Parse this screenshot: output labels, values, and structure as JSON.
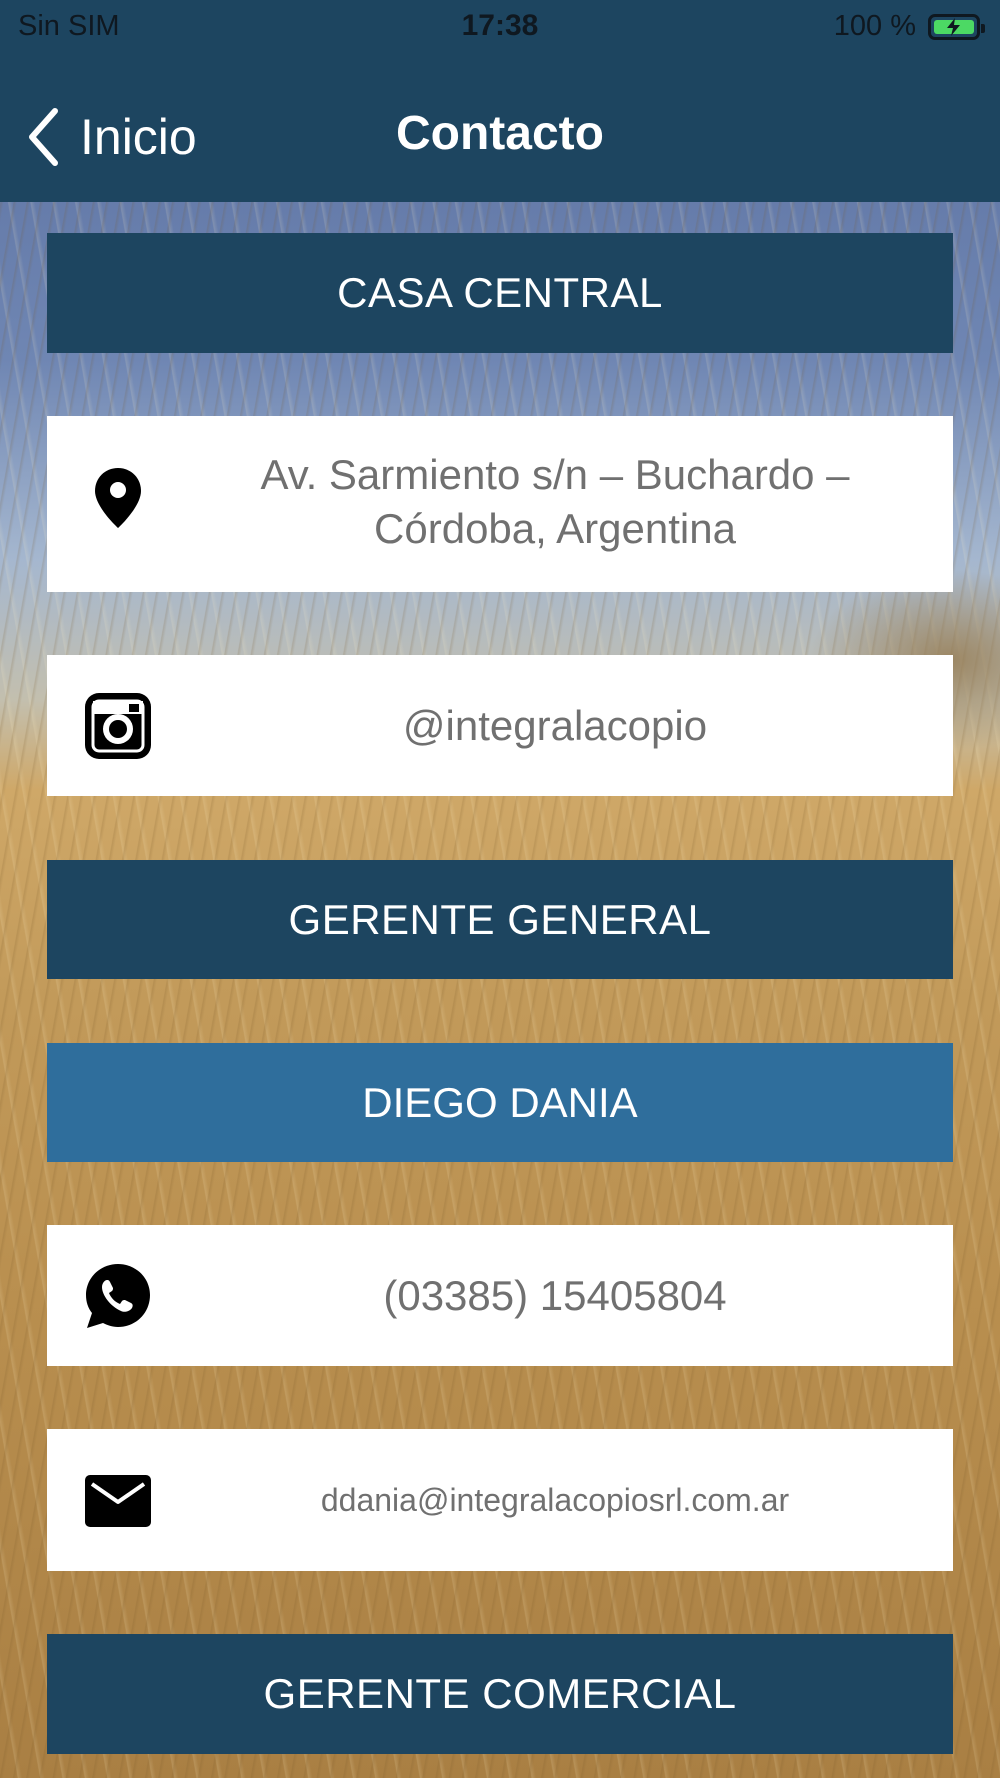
{
  "status_bar": {
    "carrier": "Sin SIM",
    "time": "17:38",
    "battery_text": "100 %",
    "battery_level": 1.0,
    "battery_color": "#4cd964"
  },
  "nav": {
    "back_label": "Inicio",
    "back_icon": "chevron-left-icon",
    "title": "Contacto"
  },
  "sections": {
    "casa_central": {
      "header": "CASA CENTRAL",
      "address": "Av. Sarmiento s/n – Buchardo – Córdoba, Argentina",
      "address_icon": "location-pin-icon",
      "instagram": "@integralacopio",
      "instagram_icon": "instagram-icon"
    },
    "gerente_general": {
      "header": "GERENTE GENERAL",
      "name": "DIEGO DANIA",
      "phone": "(03385) 15405804",
      "phone_icon": "whatsapp-icon",
      "email": "ddania@integralacopiosrl.com.ar",
      "email_icon": "mail-icon"
    },
    "gerente_comercial": {
      "header": "GERENTE COMERCIAL"
    }
  },
  "colors": {
    "header_bg": "#1d4560",
    "name_bg": "#2f6e9c",
    "card_bg": "#ffffff",
    "card_text": "#707070"
  }
}
